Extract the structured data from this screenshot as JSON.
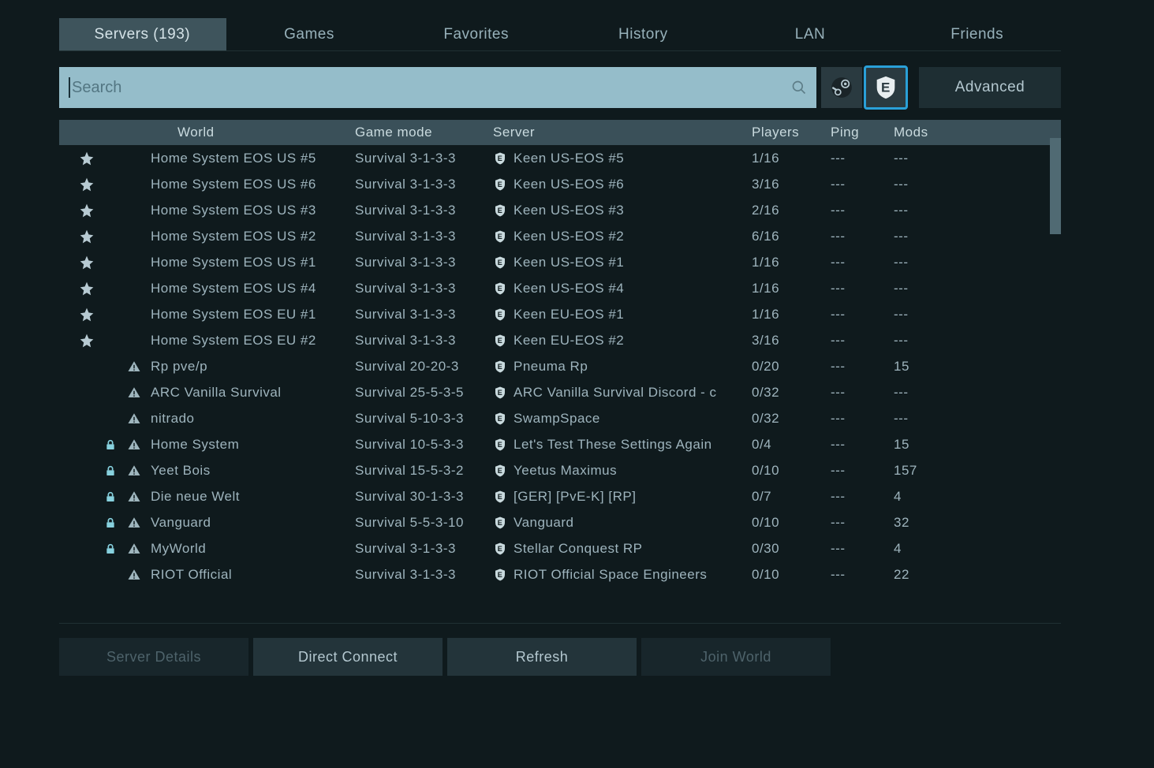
{
  "tabs": {
    "servers": "Servers (193)",
    "games": "Games",
    "favorites": "Favorites",
    "history": "History",
    "lan": "LAN",
    "friends": "Friends"
  },
  "search": {
    "placeholder": "Search"
  },
  "advanced_label": "Advanced",
  "headers": {
    "world": "World",
    "mode": "Game mode",
    "server": "Server",
    "players": "Players",
    "ping": "Ping",
    "mods": "Mods"
  },
  "servers": [
    {
      "fav": true,
      "lock": false,
      "warn": false,
      "world": "Home System EOS US #5",
      "mode": "Survival 3-1-3-3",
      "server": "Keen US-EOS #5",
      "players": "1/16",
      "ping": "---",
      "mods": "---"
    },
    {
      "fav": true,
      "lock": false,
      "warn": false,
      "world": "Home System EOS US #6",
      "mode": "Survival 3-1-3-3",
      "server": "Keen US-EOS #6",
      "players": "3/16",
      "ping": "---",
      "mods": "---"
    },
    {
      "fav": true,
      "lock": false,
      "warn": false,
      "world": "Home System EOS US #3",
      "mode": "Survival 3-1-3-3",
      "server": "Keen US-EOS #3",
      "players": "2/16",
      "ping": "---",
      "mods": "---"
    },
    {
      "fav": true,
      "lock": false,
      "warn": false,
      "world": "Home System EOS US #2",
      "mode": "Survival 3-1-3-3",
      "server": "Keen US-EOS #2",
      "players": "6/16",
      "ping": "---",
      "mods": "---"
    },
    {
      "fav": true,
      "lock": false,
      "warn": false,
      "world": "Home System EOS US #1",
      "mode": "Survival 3-1-3-3",
      "server": "Keen US-EOS #1",
      "players": "1/16",
      "ping": "---",
      "mods": "---"
    },
    {
      "fav": true,
      "lock": false,
      "warn": false,
      "world": "Home System EOS US #4",
      "mode": "Survival 3-1-3-3",
      "server": "Keen US-EOS #4",
      "players": "1/16",
      "ping": "---",
      "mods": "---"
    },
    {
      "fav": true,
      "lock": false,
      "warn": false,
      "world": "Home System EOS EU #1",
      "mode": "Survival 3-1-3-3",
      "server": "Keen EU-EOS #1",
      "players": "1/16",
      "ping": "---",
      "mods": "---"
    },
    {
      "fav": true,
      "lock": false,
      "warn": false,
      "world": "Home System EOS EU #2",
      "mode": "Survival 3-1-3-3",
      "server": "Keen EU-EOS #2",
      "players": "3/16",
      "ping": "---",
      "mods": "---"
    },
    {
      "fav": false,
      "lock": false,
      "warn": true,
      "world": "Rp pve/p",
      "mode": "Survival 20-20-3",
      "server": "Pneuma Rp",
      "players": "0/20",
      "ping": "---",
      "mods": "15"
    },
    {
      "fav": false,
      "lock": false,
      "warn": true,
      "world": "ARC Vanilla Survival",
      "mode": "Survival 25-5-3-5",
      "server": "ARC Vanilla Survival  Discord - c",
      "players": "0/32",
      "ping": "---",
      "mods": "---"
    },
    {
      "fav": false,
      "lock": false,
      "warn": true,
      "world": "nitrado",
      "mode": "Survival 5-10-3-3",
      "server": "SwampSpace",
      "players": "0/32",
      "ping": "---",
      "mods": "---"
    },
    {
      "fav": false,
      "lock": true,
      "warn": true,
      "world": "Home System",
      "mode": "Survival 10-5-3-3",
      "server": "Let's Test These Settings Again",
      "players": "0/4",
      "ping": "---",
      "mods": "15"
    },
    {
      "fav": false,
      "lock": true,
      "warn": true,
      "world": "Yeet Bois",
      "mode": "Survival 15-5-3-2",
      "server": "Yeetus Maximus",
      "players": "0/10",
      "ping": "---",
      "mods": "157"
    },
    {
      "fav": false,
      "lock": true,
      "warn": true,
      "world": "Die neue Welt",
      "mode": "Survival 30-1-3-3",
      "server": "[GER] [PvE-K] [RP]",
      "players": "0/7",
      "ping": "---",
      "mods": "4"
    },
    {
      "fav": false,
      "lock": true,
      "warn": true,
      "world": "Vanguard",
      "mode": "Survival 5-5-3-10",
      "server": "Vanguard",
      "players": "0/10",
      "ping": "---",
      "mods": "32"
    },
    {
      "fav": false,
      "lock": true,
      "warn": true,
      "world": "MyWorld",
      "mode": "Survival 3-1-3-3",
      "server": "Stellar Conquest RP",
      "players": "0/30",
      "ping": "---",
      "mods": "4"
    },
    {
      "fav": false,
      "lock": false,
      "warn": true,
      "world": "RIOT Official",
      "mode": "Survival 3-1-3-3",
      "server": "RIOT Official Space Engineers",
      "players": "0/10",
      "ping": "---",
      "mods": "22"
    }
  ],
  "footer": {
    "details": "Server Details",
    "direct": "Direct Connect",
    "refresh": "Refresh",
    "join": "Join World"
  }
}
